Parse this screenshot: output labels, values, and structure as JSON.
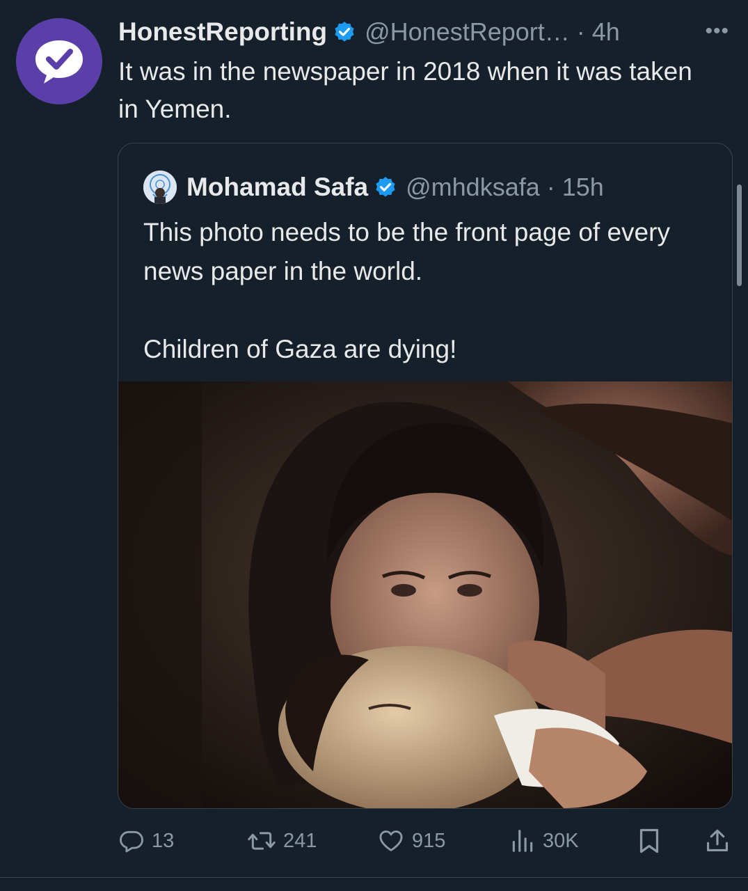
{
  "tweet": {
    "author_name": "HonestReporting",
    "author_handle": "@HonestReport…",
    "time": "4h",
    "text": "It was in the newspaper in 2018 when it was taken in Yemen.",
    "more_label": "•••",
    "avatar_icon": "checkmark-chat-icon",
    "avatar_color": "#5b3fa9"
  },
  "quoted": {
    "author_name": "Mohamad Safa",
    "author_handle": "@mhdksafa",
    "time": "15h",
    "text": "This photo needs to be the front page of every news paper in the world.\n\nChildren of Gaza are dying!"
  },
  "actions": {
    "replies": "13",
    "reposts": "241",
    "likes": "915",
    "views": "30K"
  },
  "colors": {
    "background": "#15202b",
    "text": "#e7e9ea",
    "muted": "#8b98a5",
    "verified": "#1d9bf0",
    "border": "#38444d"
  }
}
